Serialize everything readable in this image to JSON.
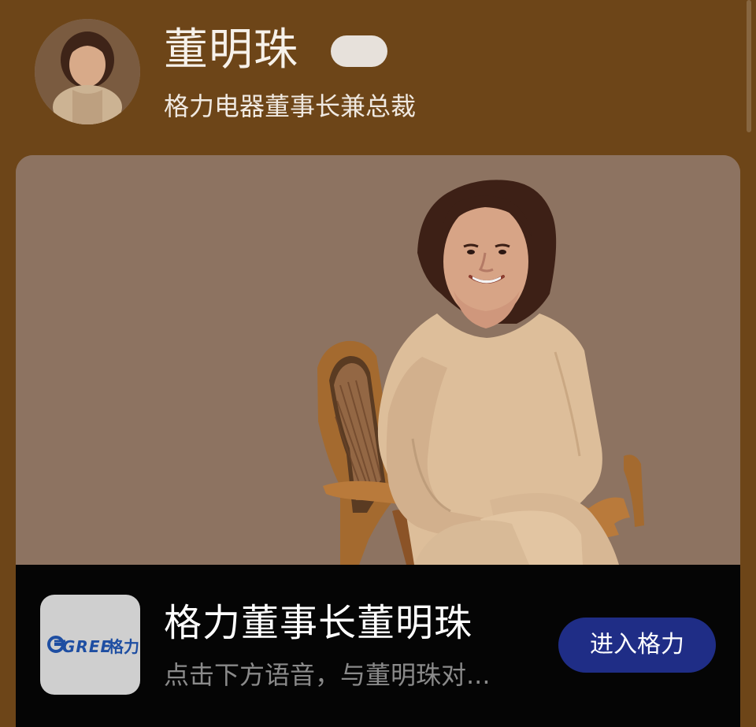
{
  "header": {
    "name": "董明珠",
    "subtitle": "格力电器董事长兼总裁"
  },
  "app": {
    "title": "格力董事长董明珠",
    "description": "点击下方语音，与董明珠对...",
    "button": "进入格力",
    "logo": {
      "wordmark": "GREE",
      "cjk": "格力"
    }
  },
  "colors": {
    "page_background": "#6d4518",
    "card_background": "#8d7361",
    "button_blue": "#1f2d86",
    "logo_blue": "#1e4ea2"
  },
  "icons": {
    "avatar": "profile-avatar",
    "verified": "verification-pill",
    "logo": "gree-logo"
  }
}
